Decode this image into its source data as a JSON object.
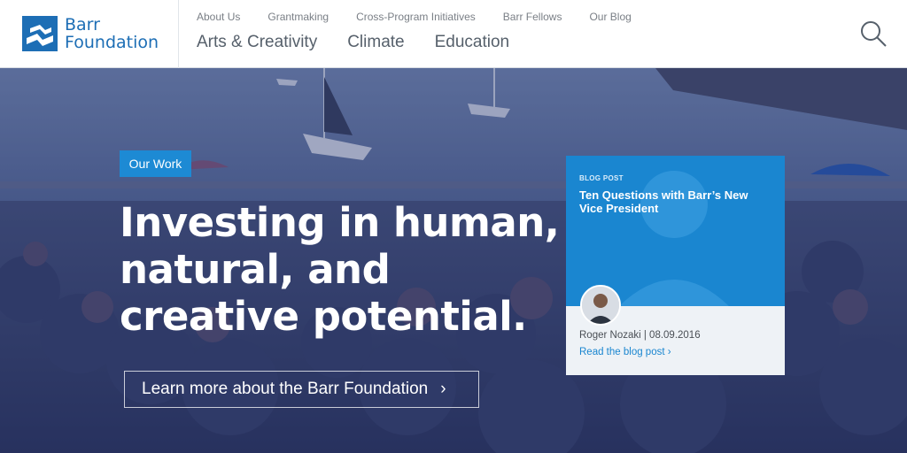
{
  "brand": {
    "line1": "Barr",
    "line2": "Foundation"
  },
  "utility_nav": [
    "About Us",
    "Grantmaking",
    "Cross-Program Initiatives",
    "Barr Fellows",
    "Our Blog"
  ],
  "main_nav": [
    "Arts & Creativity",
    "Climate",
    "Education"
  ],
  "hero": {
    "badge": "Our Work",
    "headline_lines": [
      "Investing in human,",
      "natural, and",
      "creative potential."
    ],
    "cta_label": "Learn more about the Barr Foundation",
    "cta_chevron": "›"
  },
  "blog_card": {
    "label": "BLOG POST",
    "title": "Ten Questions with Barr’s New Vice President",
    "author_line": "Roger Nozaki | 08.09.2016",
    "read_more": "Read the blog post ›"
  },
  "colors": {
    "brand_blue": "#1d6eb5",
    "accent_blue": "#1d8ad4",
    "overlay": "#2a3a80"
  },
  "icons": {
    "search": "search-icon",
    "logo": "barr-logo-mark"
  }
}
